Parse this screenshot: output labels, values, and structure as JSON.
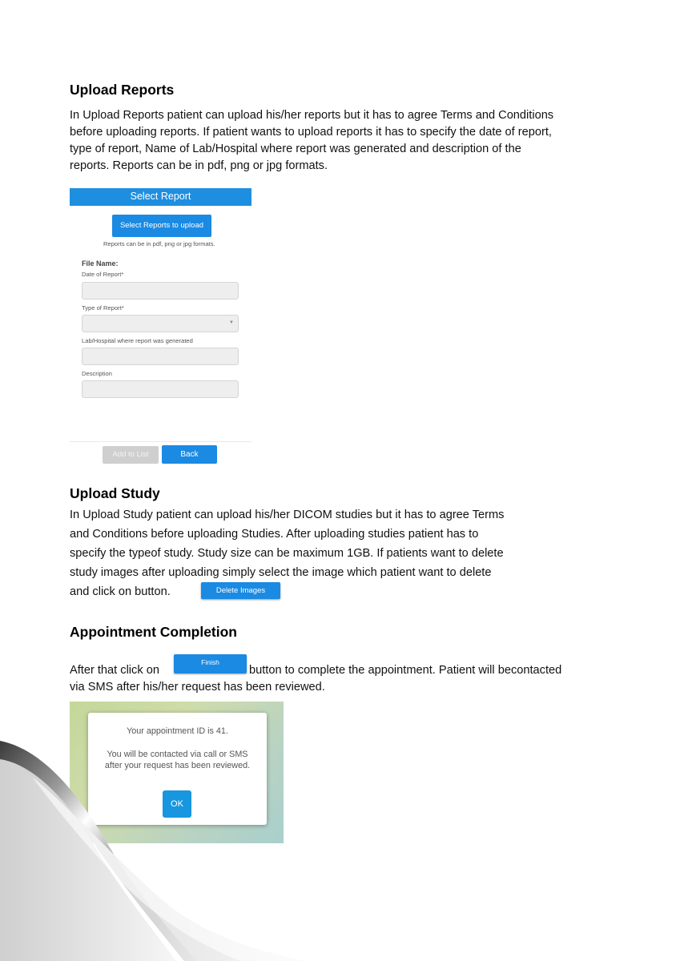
{
  "upload_reports": {
    "heading": "Upload Reports",
    "lines": [
      "In Upload Reports patient can upload his/her reports but it has to agree Terms and Conditions",
      "before uploading reports. If patient wants to upload reports it has to specify the date of report,",
      "type of report, Name of Lab/Hospital where report was generated and description of the",
      "reports. Reports can be in pdf, png or jpg formats."
    ]
  },
  "report_form": {
    "header": "Select Report",
    "select_button": "Select Reports to upload",
    "formats_note": "Reports can be in pdf, png or jpg formats.",
    "file_name_label": "File Name:",
    "date_label": "Date of Report*",
    "type_label": "Type of Report*",
    "lab_label": "Lab/Hospital where report was generated",
    "description_label": "Description",
    "add_button": "Add to List",
    "back_button": "Back"
  },
  "upload_study": {
    "heading": "Upload Study",
    "lines": [
      "In Upload Study patient can upload his/her DICOM studies but it has to agree Terms",
      "and Conditions before uploading Studies. After uploading studies patient has to",
      "specify the typeof study. Study size can be maximum 1GB. If patients want to delete",
      "study images after uploading simply select the image which patient want to delete"
    ],
    "last_line": "and click on  button.",
    "delete_button": "Delete Images"
  },
  "appointment_completion": {
    "heading": "Appointment Completion",
    "before_button": "After that click on",
    "finish_button": "Finish",
    "after_button": "button to complete the appointment. Patient will becontacted",
    "line2": "via SMS after his/her request has been reviewed."
  },
  "dialog": {
    "id_text": "Your appointment ID is 41.",
    "contact_line1": "You will be contacted via call or SMS",
    "contact_line2": "after your request has been reviewed.",
    "ok_button": "OK"
  },
  "colors": {
    "primary_blue": "#1a8ae3",
    "header_blue": "#1e8fe0"
  }
}
